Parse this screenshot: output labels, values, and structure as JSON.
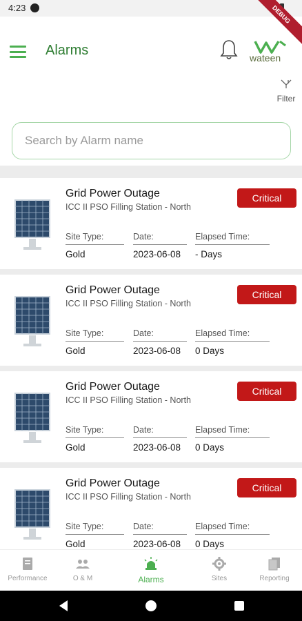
{
  "status_bar": {
    "time": "4:23",
    "debug_label": "DEBUG"
  },
  "header": {
    "title": "Alarms",
    "logo_text": "wateen",
    "filter_label": "Filter"
  },
  "search": {
    "placeholder": "Search by Alarm name"
  },
  "colors": {
    "brand_green": "#4caf50",
    "critical_red": "#c21818"
  },
  "alarms": [
    {
      "title": "Grid Power Outage",
      "site": "ICC II PSO Filling Station - North",
      "severity": "Critical",
      "site_type_label": "Site Type:",
      "site_type": "Gold",
      "date_label": "Date:",
      "date": "2023-06-08",
      "elapsed_label": "Elapsed Time:",
      "elapsed": "- Days"
    },
    {
      "title": "Grid Power Outage",
      "site": "ICC II PSO Filling Station - North",
      "severity": "Critical",
      "site_type_label": "Site Type:",
      "site_type": "Gold",
      "date_label": "Date:",
      "date": "2023-06-08",
      "elapsed_label": "Elapsed Time:",
      "elapsed": "0 Days"
    },
    {
      "title": "Grid Power Outage",
      "site": "ICC II PSO Filling Station - North",
      "severity": "Critical",
      "site_type_label": "Site Type:",
      "site_type": "Gold",
      "date_label": "Date:",
      "date": "2023-06-08",
      "elapsed_label": "Elapsed Time:",
      "elapsed": "0 Days"
    },
    {
      "title": "Grid Power Outage",
      "site": "ICC II PSO Filling Station - North",
      "severity": "Critical",
      "site_type_label": "Site Type:",
      "site_type": "Gold",
      "date_label": "Date:",
      "date": "2023-06-08",
      "elapsed_label": "Elapsed Time:",
      "elapsed": "0 Days"
    }
  ],
  "bottom_nav": {
    "items": [
      {
        "label": "Performance",
        "icon": "document-icon"
      },
      {
        "label": "O & M",
        "icon": "people-icon"
      },
      {
        "label": "Alarms",
        "icon": "siren-icon"
      },
      {
        "label": "Sites",
        "icon": "gear-icon"
      },
      {
        "label": "Reporting",
        "icon": "copy-icon"
      }
    ],
    "active_index": 2
  }
}
